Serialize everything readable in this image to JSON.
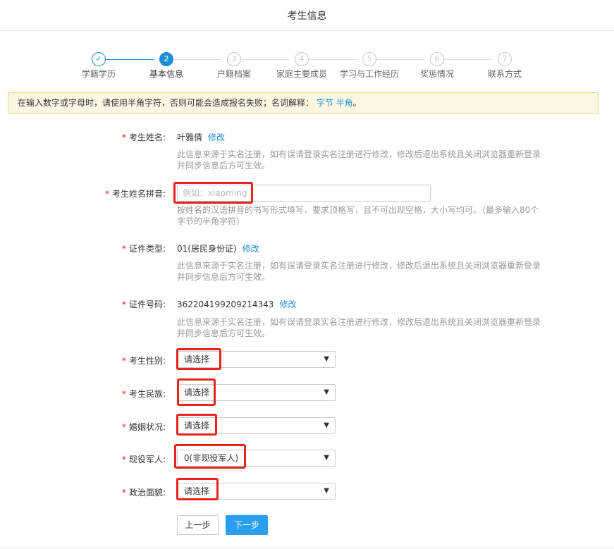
{
  "header": {
    "title": "考生信息"
  },
  "steps": [
    {
      "index": "✓",
      "label": "学籍学历",
      "state": "done"
    },
    {
      "index": "2",
      "label": "基本信息",
      "state": "active"
    },
    {
      "index": "3",
      "label": "户籍档案",
      "state": "todo"
    },
    {
      "index": "4",
      "label": "家庭主要成员",
      "state": "todo"
    },
    {
      "index": "5",
      "label": "学习与工作经历",
      "state": "todo"
    },
    {
      "index": "6",
      "label": "奖惩情况",
      "state": "todo"
    },
    {
      "index": "7",
      "label": "联系方式",
      "state": "todo"
    }
  ],
  "notice": {
    "text": "在输入数字或字母时，请使用半角字符，否则可能会造成报名失败；名词解释：",
    "link1": "字节",
    "link2": "半角",
    "end": "。"
  },
  "form": {
    "required_mark": "*",
    "name": {
      "label": "考生姓名:",
      "value": "叶雅倩",
      "edit": "修改",
      "hint": "此信息来源于实名注册，如有误请登录实名注册进行修改，修改后退出系统且关闭浏览器重新登录并同步信息后方可生效。"
    },
    "pinyin": {
      "label": "考生姓名拼音:",
      "placeholder": "例如：xiaoming",
      "value": "",
      "hint": "按姓名的汉语拼音的书写形式填写，要求顶格写，且不可出现空格，大小写均可。（最多输入80个字节的半角字符）"
    },
    "id_type": {
      "label": "证件类型:",
      "value": "01(居民身份证)",
      "edit": "修改",
      "hint": "此信息来源于实名注册，如有误请登录实名注册进行修改，修改后退出系统且关闭浏览器重新登录并同步信息后方可生效。"
    },
    "id_number": {
      "label": "证件号码:",
      "value": "362204199209214343",
      "edit": "修改",
      "hint": "此信息来源于实名注册，如有误请登录实名注册进行修改，修改后退出系统且关闭浏览器重新登录并同步信息后方可生效。"
    },
    "gender": {
      "label": "考生性别:",
      "value": "请选择"
    },
    "ethnicity": {
      "label": "考生民族:",
      "value": "请选择"
    },
    "marital": {
      "label": "婚姻状况:",
      "value": "请选择"
    },
    "military": {
      "label": "现役军人:",
      "value": "0(非现役军人)"
    },
    "political": {
      "label": "政治面貌:",
      "value": "请选择"
    }
  },
  "buttons": {
    "prev": "上一步",
    "next": "下一步"
  },
  "icons": {
    "dropdown": "caret-down-icon",
    "done_step": "check-icon"
  },
  "colors": {
    "accent": "#1e8ed8",
    "primary_button": "#2a9ef0",
    "required": "#e02020",
    "highlight_box": "#e8231c",
    "notice_bg": "#fcf7e3"
  }
}
